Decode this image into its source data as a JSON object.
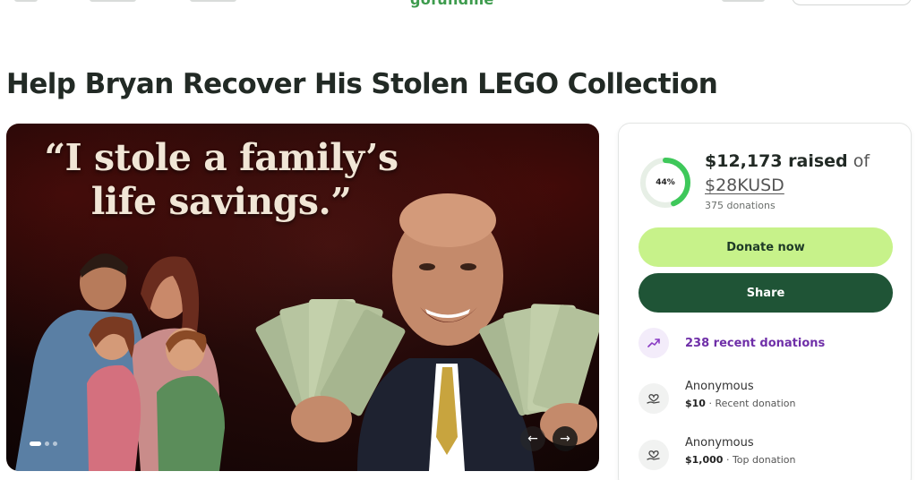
{
  "nav": {
    "logo_text": "gofundme"
  },
  "campaign": {
    "title": "Help Bryan Recover His Stolen LEGO Collection"
  },
  "hero": {
    "quote": "“I stole a family’s life savings.”",
    "slide_count": 3,
    "active_slide": 1,
    "prev_glyph": "←",
    "next_glyph": "→"
  },
  "progress": {
    "percent": 44,
    "percent_label": "44%",
    "raised": "$12,173 raised",
    "of_label": "of",
    "goal": "$28KUSD",
    "donations": "375 donations",
    "ring_color": "#3ec85a"
  },
  "buttons": {
    "donate": "Donate now",
    "share": "Share"
  },
  "recent": {
    "label": "238 recent donations",
    "icon": "trending-up-icon"
  },
  "donors": [
    {
      "name": "Anonymous",
      "amount": "$10",
      "separator": " · ",
      "note": "Recent donation",
      "icon": "heart-hand-icon"
    },
    {
      "name": "Anonymous",
      "amount": "$1,000",
      "separator": " · ",
      "note": "Top donation",
      "icon": "heart-hand-icon"
    }
  ],
  "colors": {
    "brand": "#3d9b4d",
    "donate_bg": "#c7f28a",
    "share_bg": "#1f5436",
    "recent_text": "#6f2fa8"
  }
}
